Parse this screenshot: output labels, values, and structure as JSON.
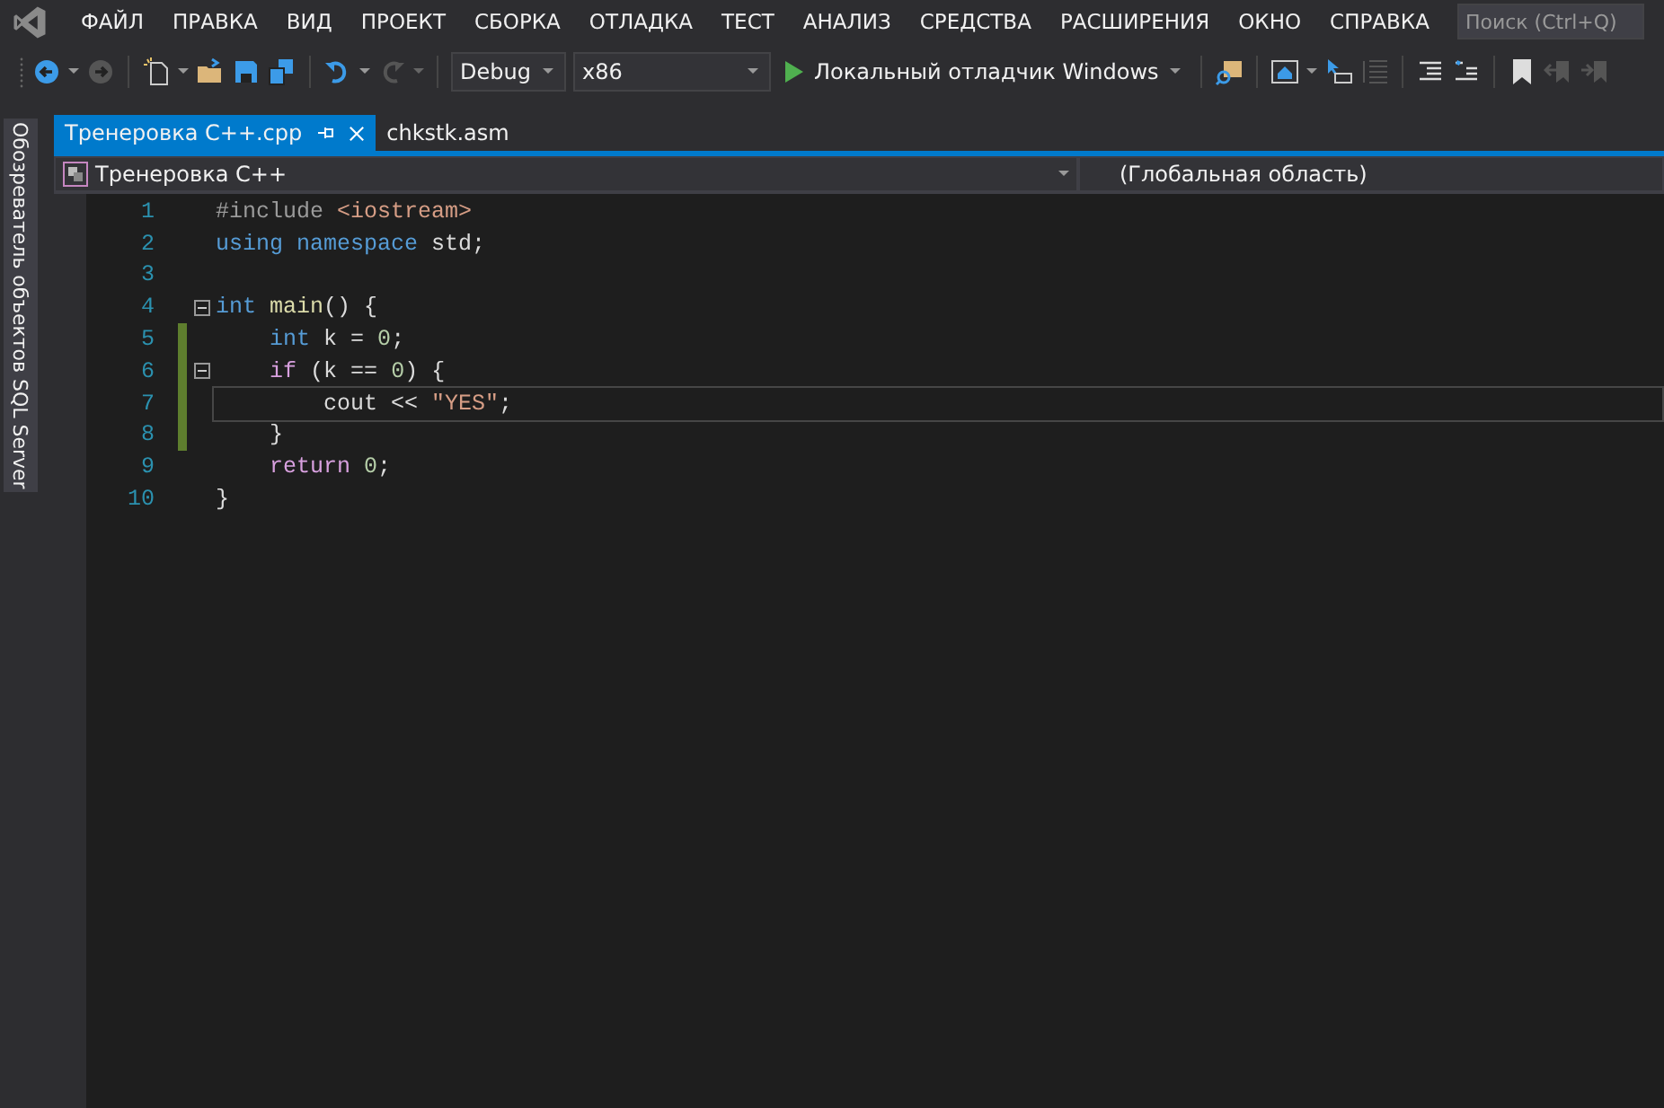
{
  "menu": [
    "ФАЙЛ",
    "ПРАВКА",
    "ВИД",
    "ПРОЕКТ",
    "СБОРКА",
    "ОТЛАДКА",
    "ТЕСТ",
    "АНАЛИЗ",
    "СРЕДСТВА",
    "РАСШИРЕНИЯ",
    "ОКНО",
    "СПРАВКА"
  ],
  "search": {
    "placeholder": "Поиск (Ctrl+Q)"
  },
  "toolbar": {
    "configuration": "Debug",
    "platform": "x86",
    "run_label": "Локальный отладчик Windows"
  },
  "side_panel": {
    "label": "Обозреватель объектов SQL Server"
  },
  "tabs": [
    {
      "label": "Тренеровка C++.cpp",
      "selected": true
    },
    {
      "label": "chkstk.asm",
      "selected": false
    }
  ],
  "nav_bar": {
    "project": "Тренеровка C++",
    "scope": "(Глобальная область)"
  },
  "code": [
    {
      "number": "1",
      "changed": false,
      "fold": false,
      "current": false,
      "tokens": [
        {
          "kind": "pre",
          "text": "#include "
        },
        {
          "kind": "inc",
          "text": "<iostream>"
        }
      ]
    },
    {
      "number": "2",
      "changed": false,
      "fold": false,
      "current": false,
      "tokens": [
        {
          "kind": "kw",
          "text": "using "
        },
        {
          "kind": "kw",
          "text": "namespace "
        },
        {
          "kind": "plain",
          "text": "std;"
        }
      ]
    },
    {
      "number": "3",
      "changed": false,
      "fold": false,
      "current": false
    },
    {
      "number": "4",
      "changed": false,
      "fold": true,
      "current": false,
      "tokens": [
        {
          "kind": "kw",
          "text": "int "
        },
        {
          "kind": "fn",
          "text": "main"
        },
        {
          "kind": "plain",
          "text": "() {"
        }
      ]
    },
    {
      "number": "5",
      "changed": true,
      "fold": false,
      "current": false,
      "tokens": [
        {
          "kind": "indent"
        },
        {
          "kind": "kw",
          "text": "int "
        },
        {
          "kind": "var",
          "text": "k"
        },
        {
          "kind": "plain",
          "text": " = "
        },
        {
          "kind": "num",
          "text": "0"
        },
        {
          "kind": "plain",
          "text": ";"
        }
      ]
    },
    {
      "number": "6",
      "changed": true,
      "fold": true,
      "current": false,
      "tokens": [
        {
          "kind": "indent"
        },
        {
          "kind": "ctrl",
          "text": "if"
        },
        {
          "kind": "plain",
          "text": " ("
        },
        {
          "kind": "var",
          "text": "k"
        },
        {
          "kind": "plain",
          "text": " == "
        },
        {
          "kind": "num",
          "text": "0"
        },
        {
          "kind": "plain",
          "text": ") {"
        }
      ]
    },
    {
      "number": "7",
      "changed": true,
      "fold": false,
      "current": true,
      "tokens": [
        {
          "kind": "indent"
        },
        {
          "kind": "indent"
        },
        {
          "kind": "var",
          "text": "cout"
        },
        {
          "kind": "plain",
          "text": " << "
        },
        {
          "kind": "str",
          "text": "\"YES\""
        },
        {
          "kind": "plain",
          "text": ";"
        }
      ]
    },
    {
      "number": "8",
      "changed": true,
      "fold": false,
      "current": false,
      "tokens": [
        {
          "kind": "indent"
        },
        {
          "kind": "plain",
          "text": "}"
        }
      ]
    },
    {
      "number": "9",
      "changed": false,
      "fold": false,
      "current": false,
      "tokens": [
        {
          "kind": "indent"
        },
        {
          "kind": "ctrl",
          "text": "return "
        },
        {
          "kind": "num",
          "text": "0"
        },
        {
          "kind": "plain",
          "text": ";"
        }
      ]
    },
    {
      "number": "10",
      "changed": false,
      "fold": false,
      "current": false,
      "tokens": [
        {
          "kind": "plain",
          "text": "}"
        }
      ]
    }
  ]
}
